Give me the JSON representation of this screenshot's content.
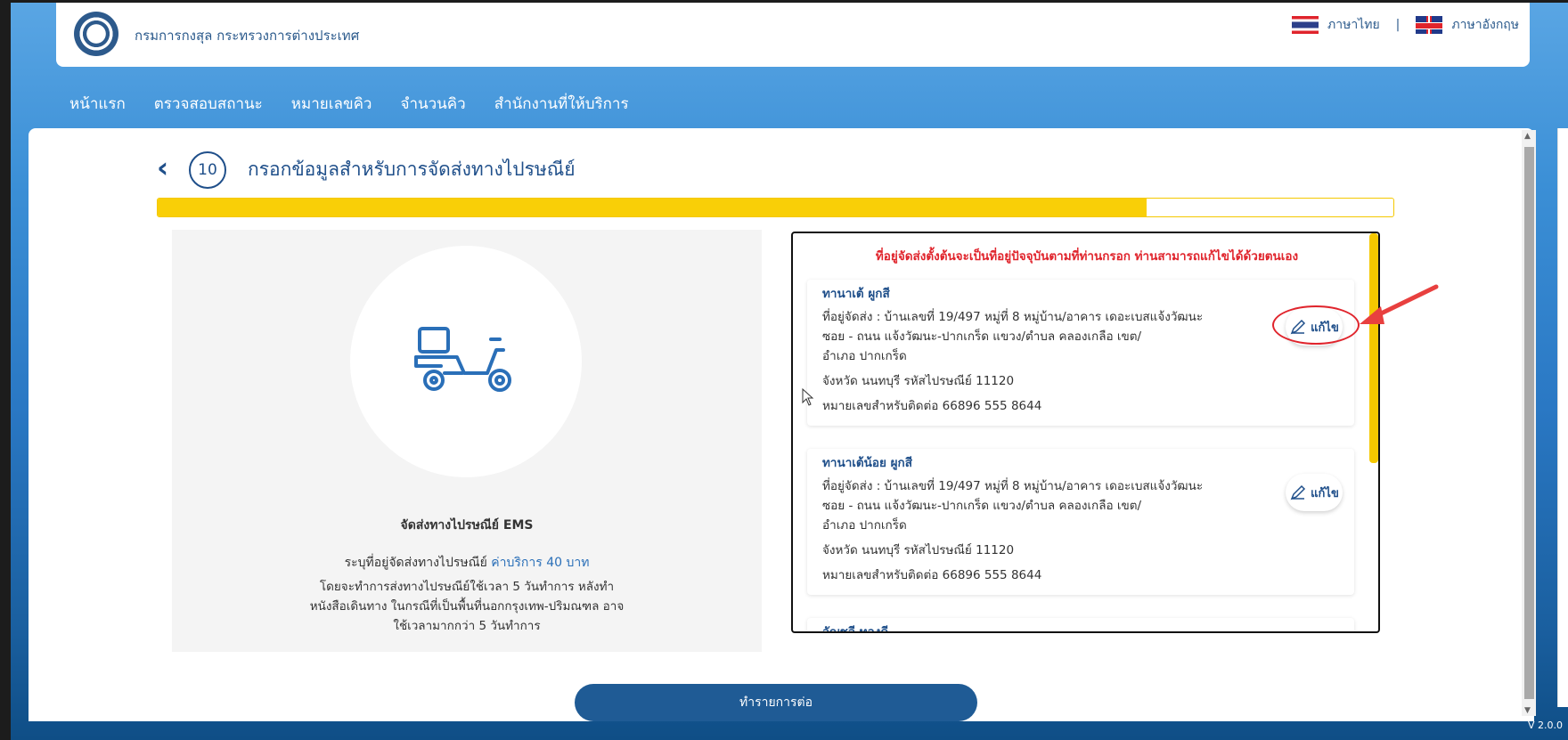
{
  "header": {
    "org_name": "กรมการกงสุล กระทรวงการต่างประเทศ",
    "lang_thai": "ภาษาไทย",
    "separator": "|",
    "lang_english": "ภาษาอังกฤษ"
  },
  "nav": {
    "items": [
      "หน้าแรก",
      "ตรวจสอบสถานะ",
      "หมายเลขคิว",
      "จำนวนคิว",
      "สำนักงานที่ให้บริการ"
    ]
  },
  "step": {
    "number": "10",
    "title": "กรอกข้อมูลสำหรับการจัดส่งทางไปรษณีย์",
    "progress_percent": 80
  },
  "delivery": {
    "title": "จัดส่งทางไปรษณีย์ EMS",
    "address_label": "ระบุที่อยู่จัดส่งทางไปรษณีย์",
    "fee": "ค่าบริการ 40 บาท",
    "desc_1": "โดยจะทำการส่งทางไปรษณีย์ใช้เวลา 5 วันทำการ หลังทำ",
    "desc_2": "หนังสือเดินทาง ในกรณีที่เป็นพื้นที่นอกกรุงเทพ-ปริมณฑล อาจ",
    "desc_3": "ใช้เวลามากกว่า 5 วันทำการ"
  },
  "addresses": {
    "notice": "ที่อยู่จัดส่งตั้งต้นจะเป็นที่อยู่ปัจจุบันตามที่ท่านกรอก ท่านสามารถแก้ไขได้ด้วยตนเอง",
    "edit_label": "แก้ไข",
    "cards": [
      {
        "name": "ทานาเต้ ผูกสี",
        "line1": "ที่อยู่จัดส่ง :   บ้านเลขที่ 19/497  หมู่ที่ 8  หมู่บ้าน/อาคาร เดอะเบสแจ้งวัฒนะ",
        "line2": "ซอย - ถนน แจ้งวัฒนะ-ปากเกร็ด  แขวง/ตำบล คลองเกลือ  เขต/",
        "line3": "อำเภอ ปากเกร็ด",
        "line4": "จังหวัด นนทบุรี  รหัสไปรษณีย์ 11120",
        "line5": "หมายเลขสำหรับติดต่อ  66896 555 8644"
      },
      {
        "name": "ทานาเต้น้อย ผูกสี",
        "line1": "ที่อยู่จัดส่ง :   บ้านเลขที่ 19/497  หมู่ที่ 8  หมู่บ้าน/อาคาร เดอะเบสแจ้งวัฒนะ",
        "line2": "ซอย - ถนน แจ้งวัฒนะ-ปากเกร็ด  แขวง/ตำบล คลองเกลือ  เขต/",
        "line3": "อำเภอ ปากเกร็ด",
        "line4": "จังหวัด นนทบุรี  รหัสไปรษณีย์ 11120",
        "line5": "หมายเลขสำหรับติดต่อ  66896 555 8644"
      },
      {
        "name": "อัญชลี ทองดี"
      }
    ]
  },
  "actions": {
    "continue": "ทำรายการต่อ"
  },
  "footer": {
    "version": "V 2.0.0"
  },
  "colors": {
    "primary": "#1f4f8a",
    "accent_yellow": "#f9cf07",
    "notice_red": "#e0242c"
  }
}
